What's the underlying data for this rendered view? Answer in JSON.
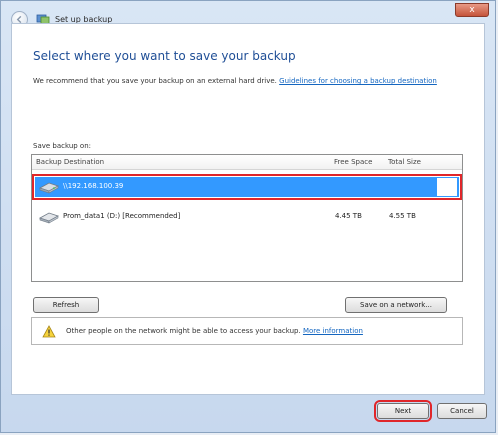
{
  "window": {
    "title": "Set up backup",
    "close_label": "x"
  },
  "page": {
    "heading": "Select where you want to save your backup",
    "recommend_text": "We recommend that you save your backup on an external hard drive.",
    "guidelines_link": "Guidelines for choosing a backup destination",
    "save_label": "Save backup on:"
  },
  "table": {
    "columns": [
      "Backup Destination",
      "Free Space",
      "Total Size"
    ],
    "rows": [
      {
        "name": "\\\\192.168.100.39",
        "free": "",
        "total": "",
        "selected": true,
        "icon": "network-drive-icon"
      },
      {
        "name": "Prom_data1 (D:) [Recommended]",
        "free": "4.45 TB",
        "total": "4.55 TB",
        "selected": false,
        "icon": "hard-drive-icon"
      }
    ]
  },
  "buttons": {
    "refresh": "Refresh",
    "save_network": "Save on a network...",
    "next": "Next",
    "cancel": "Cancel"
  },
  "warning": {
    "text": "Other people on the network might be able to access your backup.",
    "link": "More information",
    "icon": "warning-icon"
  },
  "colors": {
    "heading": "#1f4e96",
    "link": "#1466c0",
    "selection": "#3399ff",
    "highlight": "#e0262a"
  }
}
